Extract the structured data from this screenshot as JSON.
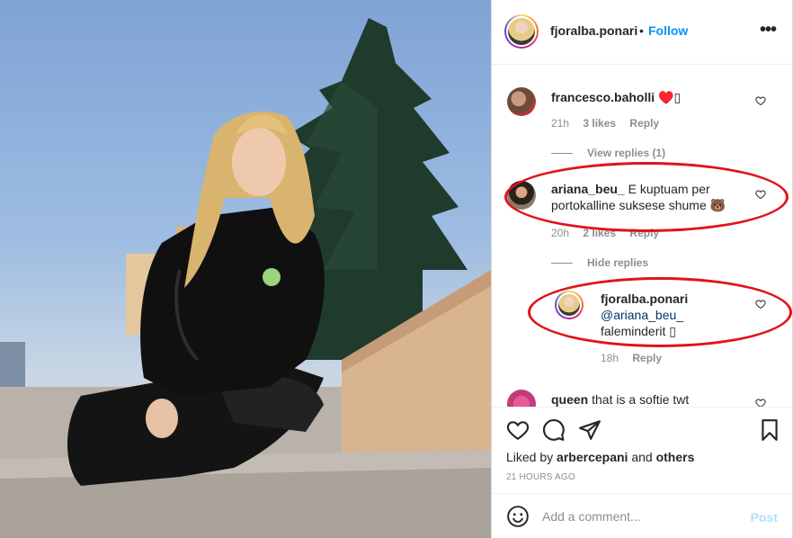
{
  "post": {
    "author": "fjoralba.ponari",
    "separator": "•",
    "follow_label": "Follow",
    "more_icon": "more-horizontal-icon",
    "more_label": "•••"
  },
  "comments": [
    {
      "username": "francesco.baholli",
      "text": "♥️▯",
      "time": "21h",
      "likes": "3 likes",
      "reply_label": "Reply",
      "replies_toggle": "View replies (1)"
    },
    {
      "username": "ariana_beu_",
      "text": "E kuptuam per portokalline suksese shume 🐻",
      "time": "20h",
      "likes": "2 likes",
      "reply_label": "Reply",
      "replies_toggle": "Hide replies",
      "highlighted": true
    },
    {
      "username": "fjoralba.ponari",
      "mention": "@ariana_beu_",
      "text": "faleminderit ▯",
      "time": "18h",
      "reply_label": "Reply",
      "is_reply": true,
      "highlighted": true
    },
    {
      "username": "queen",
      "text": "that is a softie twt",
      "partial": true
    }
  ],
  "footer": {
    "liked_by_prefix": "Liked by",
    "liked_by_user": "arbercepani",
    "liked_by_and": "and",
    "liked_by_others": "others",
    "timestamp": "21 HOURS AGO",
    "comment_placeholder": "Add a comment...",
    "post_label": "Post"
  },
  "colors": {
    "accent": "#0095f6",
    "annotation": "#e0141b",
    "post_disabled": "#b2dffc",
    "muted": "#8e8e8e"
  }
}
